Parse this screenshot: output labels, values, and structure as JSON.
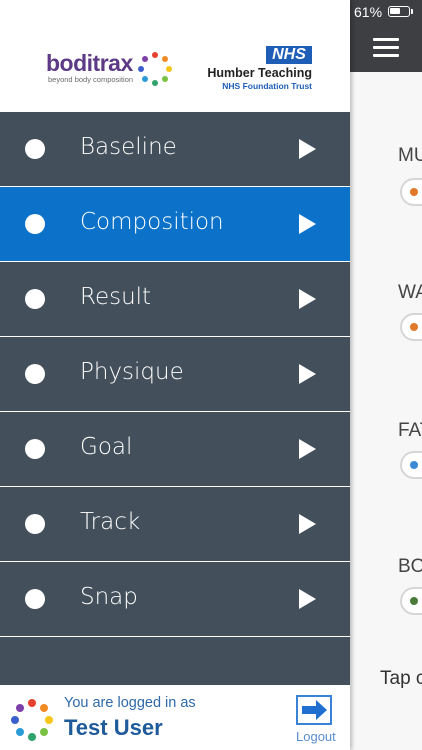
{
  "status_bar": {
    "battery_percent": "61%",
    "battery_level": 0.61
  },
  "main": {
    "metrics": [
      {
        "label": "MU",
        "dot_color": "#e07a2a"
      },
      {
        "label": "WA",
        "dot_color": "#e07a2a"
      },
      {
        "label": "FAT",
        "dot_color": "#3a8ad6"
      },
      {
        "label": "BO",
        "dot_color": "#4a7a3a"
      }
    ],
    "tap_text": "Tap c"
  },
  "menu": {
    "brand": {
      "name": "boditrax",
      "tagline": "beyond body composition"
    },
    "partner": {
      "badge": "NHS",
      "line1": "Humber Teaching",
      "line2": "NHS Foundation Trust"
    },
    "items": [
      {
        "label": "Baseline",
        "active": false
      },
      {
        "label": "Composition",
        "active": true
      },
      {
        "label": "Result",
        "active": false
      },
      {
        "label": "Physique",
        "active": false
      },
      {
        "label": "Goal",
        "active": false
      },
      {
        "label": "Track",
        "active": false
      },
      {
        "label": "Snap",
        "active": false
      }
    ],
    "colors": {
      "menu_bg": "#43505c",
      "active_bg": "#0b71c9",
      "brand_purple": "#5d3a86",
      "nhs_blue": "#1e5eb6"
    }
  },
  "footer": {
    "logged_in_label": "You are logged in as",
    "user_name": "Test User",
    "logout_label": "Logout"
  }
}
